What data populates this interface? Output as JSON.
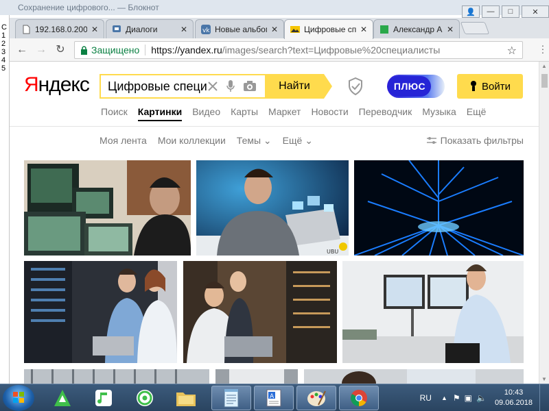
{
  "background_window": {
    "title": "Сохранение цифрового... — Блокнот",
    "line_numbers": [
      "С",
      "1",
      "2",
      "3",
      "4",
      "5"
    ]
  },
  "browser": {
    "tabs": [
      {
        "label": "192.168.0.200",
        "icon": "page-icon",
        "active": false
      },
      {
        "label": "Диалоги",
        "icon": "chat-icon",
        "active": false
      },
      {
        "label": "Новые альбомы",
        "icon": "vk-icon",
        "active": false
      },
      {
        "label": "Цифровые специалисты",
        "icon": "image-icon",
        "active": true
      },
      {
        "label": "Александр А...",
        "icon": "green-square-icon",
        "active": false
      }
    ],
    "window_controls": {
      "user": "👤",
      "minimize": "—",
      "maximize": "□",
      "close": "✕"
    },
    "secure_label": "Защищено",
    "url_host": "https://yandex.ru",
    "url_path": "/images/search?text=Цифровые%20специалисты"
  },
  "yandex": {
    "logo_first": "Я",
    "logo_rest": "ндекс",
    "search_value": "Цифровые специалисты",
    "find_button": "Найти",
    "plus_label": "ПЛЮС",
    "login_button": "Войти",
    "services": [
      {
        "label": "Поиск",
        "active": false
      },
      {
        "label": "Картинки",
        "active": true
      },
      {
        "label": "Видео",
        "active": false
      },
      {
        "label": "Карты",
        "active": false
      },
      {
        "label": "Маркет",
        "active": false
      },
      {
        "label": "Новости",
        "active": false
      },
      {
        "label": "Переводчик",
        "active": false
      },
      {
        "label": "Музыка",
        "active": false
      },
      {
        "label": "Ещё",
        "active": false
      }
    ],
    "subnav": [
      "Моя лента",
      "Мои коллекции",
      "Темы ⌄",
      "Ещё ⌄"
    ],
    "filters_label": "Показать фильтры",
    "image_badge": "UBU"
  },
  "taskbar": {
    "language": "RU",
    "time": "10:43",
    "date": "09.06.2018"
  },
  "colors": {
    "yandex_yellow": "#ffdb4d",
    "yandex_red": "#ff0000",
    "plus_blue": "#2624d6",
    "secure_green": "#0b8043"
  }
}
